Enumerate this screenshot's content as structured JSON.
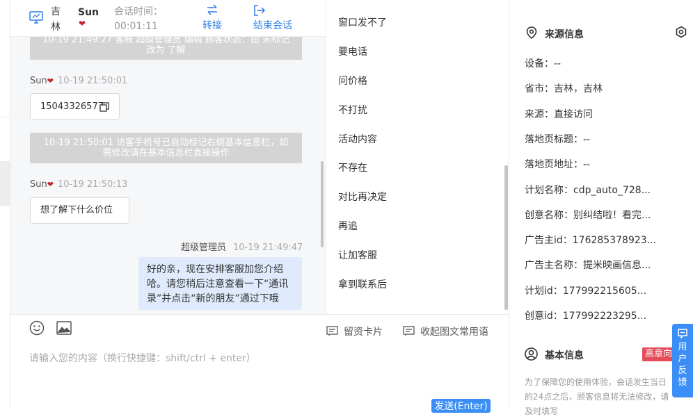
{
  "header": {
    "location": "吉林",
    "visitor_name": "Sun",
    "time_label": "会话时间：",
    "time_value": "00:01:11",
    "transfer_label": "转接",
    "end_label": "结束会话"
  },
  "messages": [
    {
      "type": "system",
      "text": "10-19 21:49:27 客服 超级管理员 编辑 顾客状态：由 未标记 改为 了解"
    },
    {
      "sender": "Sun",
      "time": "10-19 21:50:01",
      "text": "15043326577"
    },
    {
      "type": "system",
      "text": "10-19 21:50:01 访客手机号已自动标记右侧基本信息栏，如需修改请在基本信息栏直接操作"
    },
    {
      "sender": "Sun",
      "time": "10-19 21:50:13",
      "text": "想了解下什么价位"
    },
    {
      "sender": "超级管理员",
      "time": "10-19 21:49:47",
      "text": "好的亲，现在安排客服加您介绍哈。请您稍后注意查看一下“通讯录”并点击“新的朋友”通过下哦"
    }
  ],
  "composer": {
    "card_label": "留资卡片",
    "collapse_label": "收起图文常用语",
    "placeholder": "请输入您的内容（换行快捷键：shift/ctrl + enter）",
    "send_label": "发送(Enter)"
  },
  "quick_replies": [
    "窗口发不了",
    "要电话",
    "问价格",
    "不打扰",
    "活动内容",
    "不存在",
    "对比再决定",
    "再追",
    "让加客服",
    "拿到联系后"
  ],
  "source_info": {
    "title": "来源信息",
    "rows": [
      "设备：--",
      "省市：吉林，吉林",
      "来源：直接访问",
      "落地页标题：--",
      "落地页地址：--",
      "计划名称：cdp_auto_728...",
      "创意名称：别纠结啦！看完...",
      "广告主id：176285378923...",
      "广告主名称：提米映画信息...",
      "计划id：177992215605...",
      "创意id：177992223295..."
    ]
  },
  "basic_info": {
    "title": "基本信息",
    "badge": "高意向",
    "notice": "为了保障您的使用体验，会话发生当日的24点之后，顾客信息将无法修改，请及时填写"
  },
  "feedback": {
    "label": "用户反馈"
  },
  "colors": {
    "accent": "#2d7be5",
    "badge": "#e34d59",
    "system_bg": "#d4d4d4",
    "my_bubble": "#dfebfc"
  }
}
